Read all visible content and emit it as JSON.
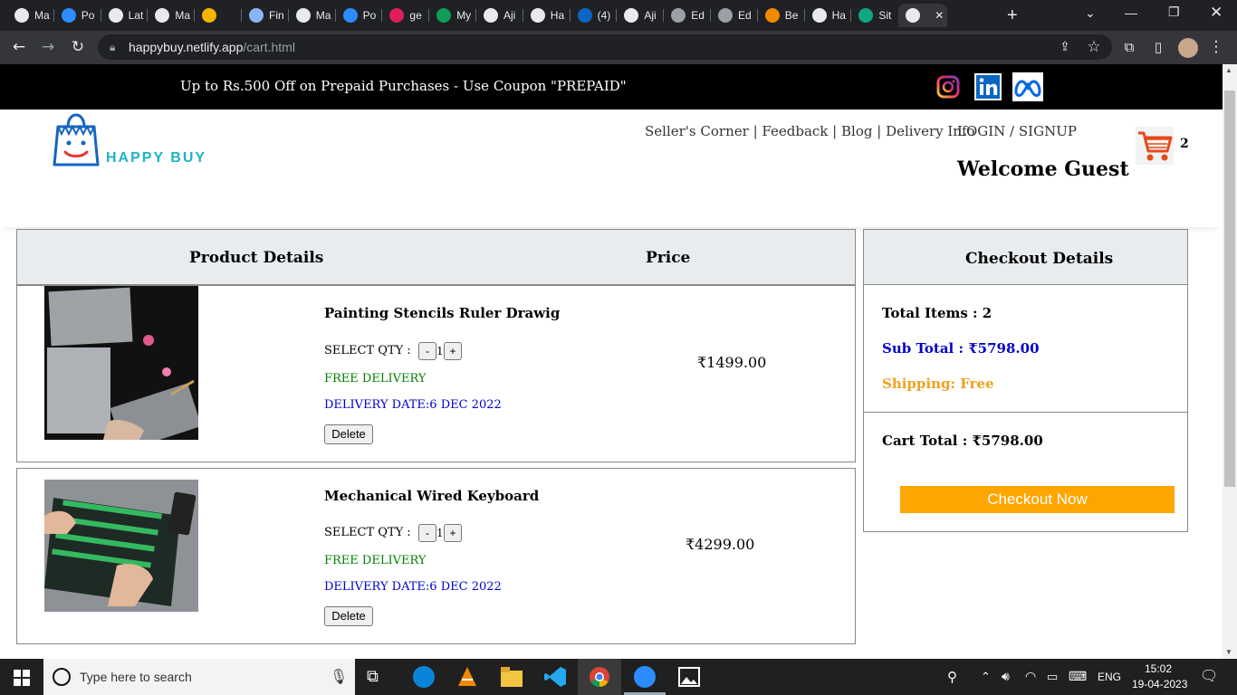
{
  "browser": {
    "tabs": [
      "Ma",
      "Po",
      "Lat",
      "Ma",
      "",
      "Fin",
      "Ma",
      "Po",
      "ge",
      "My",
      "Aji",
      "Ha",
      "(4)",
      "Aji",
      "Ed",
      "Ed",
      "Be",
      "Ha",
      "Sit",
      ""
    ],
    "url_host": "happybuy.netlify.app",
    "url_path": "/cart.html"
  },
  "promo": {
    "text": "Up to Rs.500 Off on Prepaid Purchases - Use Coupon \"PREPAID\""
  },
  "header": {
    "brand": "HAPPY BUY",
    "nav": [
      "Seller's Corner",
      "Feedback",
      "Blog",
      "Delivery Info"
    ],
    "nav_sep": "|",
    "login": "LOGIN / SIGNUP",
    "welcome": "Welcome Guest",
    "cart_count": "2"
  },
  "cart": {
    "col_product": "Product Details",
    "col_price": "Price",
    "qty_label": "SELECT QTY :",
    "minus": "-",
    "plus": "+",
    "delete": "Delete",
    "items": [
      {
        "name": "Painting Stencils Ruler Drawig",
        "qty": "1",
        "free": "FREE DELIVERY",
        "date": "DELIVERY DATE:6 DEC 2022",
        "price": "₹1499.00"
      },
      {
        "name": "Mechanical Wired Keyboard",
        "qty": "1",
        "free": "FREE DELIVERY",
        "date": "DELIVERY DATE:6 DEC 2022",
        "price": "₹4299.00"
      }
    ]
  },
  "checkout": {
    "title": "Checkout Details",
    "total_items": "Total Items : 2",
    "sub_total": "Sub Total : ₹5798.00",
    "shipping": "Shipping: Free",
    "cart_total": "Cart Total : ₹5798.00",
    "button": "Checkout Now"
  },
  "taskbar": {
    "search_placeholder": "Type here to search",
    "lang": "ENG",
    "time": "15:02",
    "date": "19-04-2023"
  },
  "colors": {
    "accent_orange": "#ffa500",
    "brand_teal": "#1fb3c6",
    "subtotal_blue": "#0000cc",
    "free_green": "#008000",
    "shipping_orange": "#f0a020"
  }
}
